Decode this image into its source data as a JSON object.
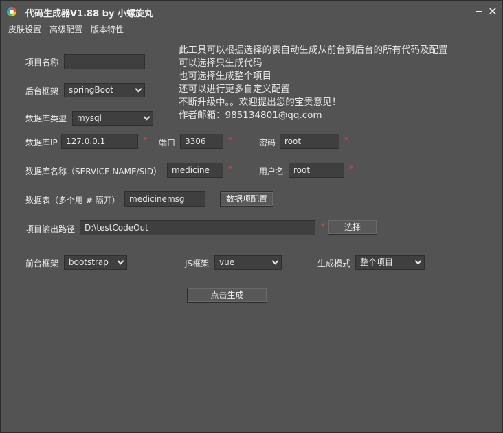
{
  "window": {
    "title": "代码生成器V1.88 by 小螺旋丸",
    "minimize": "−",
    "close": "✕"
  },
  "menu": [
    "皮肤设置",
    "高级配置",
    "版本特性"
  ],
  "info_lines": [
    "此工具可以根据选择的表自动生成从前台到后台的所有代码及配置",
    "可以选择只生成代码",
    "也可选择生成整个项目",
    "还可以进行更多自定义配置",
    "不断升级中。。欢迎提出您的宝贵意见！",
    "作者邮箱：985134801@qq.com"
  ],
  "form": {
    "project_name": {
      "label": "项目名称",
      "value": ""
    },
    "backend_framework": {
      "label": "后台框架",
      "value": "springBoot"
    },
    "db_type": {
      "label": "数据库类型",
      "value": "mysql"
    },
    "db_ip": {
      "label": "数据库IP",
      "value": "127.0.0.1"
    },
    "port": {
      "label": "端口",
      "value": "3306"
    },
    "password": {
      "label": "密码",
      "value": "root"
    },
    "db_name": {
      "label": "数据库名称（SERVICE NAME/SID）",
      "value": "medicine"
    },
    "username": {
      "label": "用户名",
      "value": "root"
    },
    "tables": {
      "label": "数据表（多个用 # 隔开）",
      "value": "medicinemsg"
    },
    "table_config_button": "数据项配置",
    "output_path": {
      "label": "项目输出路径",
      "value": "D:\\testCodeOut"
    },
    "choose_button": "选择",
    "frontend_framework": {
      "label": "前台框架",
      "value": "bootstrap"
    },
    "js_framework": {
      "label": "JS框架",
      "value": "vue"
    },
    "gen_mode": {
      "label": "生成模式",
      "value": "整个项目"
    },
    "generate_button": "点击生成",
    "required_mark": "*"
  },
  "colors": {
    "background": "#535353",
    "input_bg": "#3f3f3f",
    "required": "#e04848",
    "text": "#e8e8e8"
  }
}
